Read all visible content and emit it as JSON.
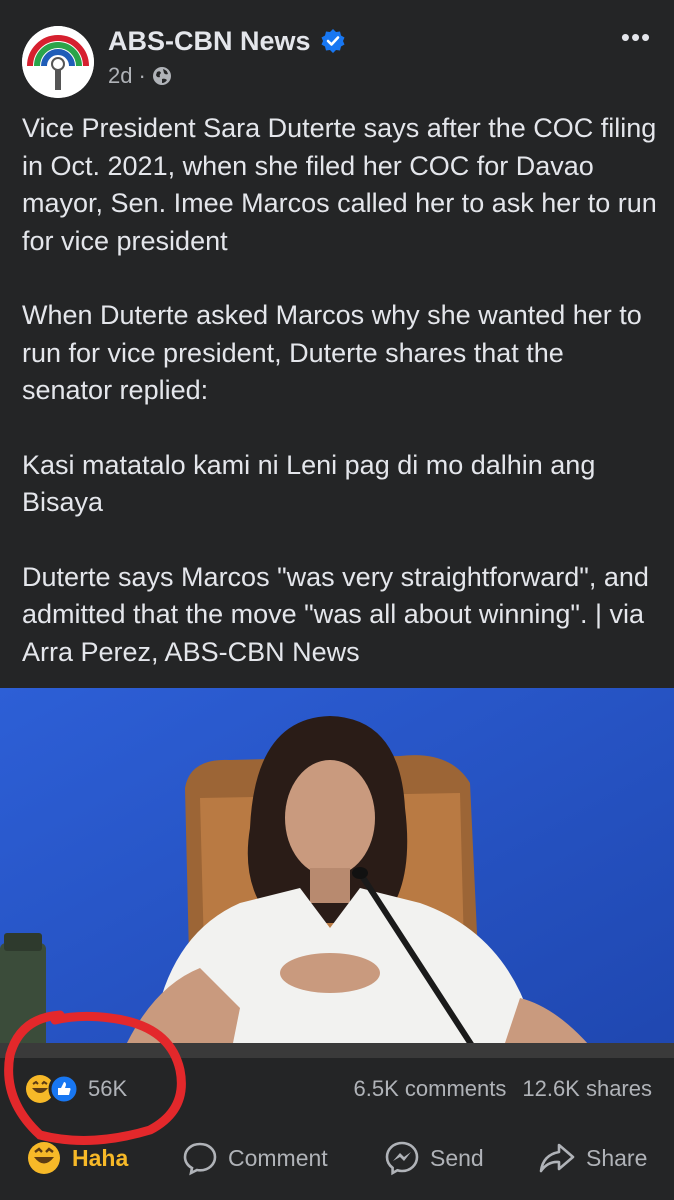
{
  "header": {
    "page_name": "ABS-CBN News",
    "time": "2d",
    "separator": "·",
    "audience_icon": "globe-icon",
    "verified_icon": "verified-badge-icon",
    "more_icon": "more-options-icon",
    "more_label": "•••"
  },
  "post": {
    "paragraphs": [
      "Vice President Sara Duterte says after the COC filing in Oct. 2021, when she filed her COC for Davao mayor, Sen. Imee Marcos called her to ask her to run for vice president",
      "When Duterte asked Marcos why she wanted her to run for vice president, Duterte shares that the senator replied:",
      "Kasi matatalo kami ni Leni pag di mo dalhin ang Bisaya",
      "Duterte says Marcos \"was very straightforward\", and admitted that the move \"was all about winning\". | via Arra Perez, ABS-CBN News"
    ]
  },
  "stats": {
    "reactions": "56K",
    "comments": "6.5K comments",
    "shares": "12.6K shares"
  },
  "actions": {
    "haha": "Haha",
    "comment": "Comment",
    "send": "Send",
    "share": "Share"
  },
  "colors": {
    "background": "#242526",
    "text": "#e4e6eb",
    "muted": "#b0b3b8",
    "haha": "#f7b928",
    "like": "#1877f2",
    "annotation": "#e3282b"
  }
}
